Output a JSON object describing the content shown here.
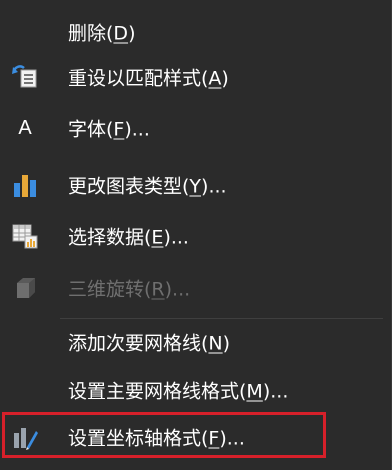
{
  "menu": {
    "items": [
      {
        "pre": "删除(",
        "key": "D",
        "post": ")",
        "icon": "none",
        "disabled": false
      },
      {
        "pre": "重设以匹配样式(",
        "key": "A",
        "post": ")",
        "icon": "reset-style-icon",
        "disabled": false
      },
      {
        "pre": "字体(",
        "key": "F",
        "post": ")...",
        "icon": "font-icon",
        "disabled": false
      },
      {
        "pre": "更改图表类型(",
        "key": "Y",
        "post": ")...",
        "icon": "bar-chart-icon",
        "disabled": false
      },
      {
        "pre": "选择数据(",
        "key": "E",
        "post": ")...",
        "icon": "select-data-icon",
        "disabled": false
      },
      {
        "pre": "三维旋转(",
        "key": "R",
        "post": ")...",
        "icon": "3d-rotate-icon",
        "disabled": true
      },
      {
        "pre": "添加次要网格线(",
        "key": "N",
        "post": ")",
        "icon": "none",
        "disabled": false
      },
      {
        "pre": "设置主要网格线格式(",
        "key": "M",
        "post": ")...",
        "icon": "none",
        "disabled": false
      },
      {
        "pre": "设置坐标轴格式(",
        "key": "F",
        "post": ")...",
        "icon": "format-axis-icon",
        "disabled": false
      }
    ],
    "font_icon_glyph": "A",
    "highlight_color": "#d6202a"
  }
}
